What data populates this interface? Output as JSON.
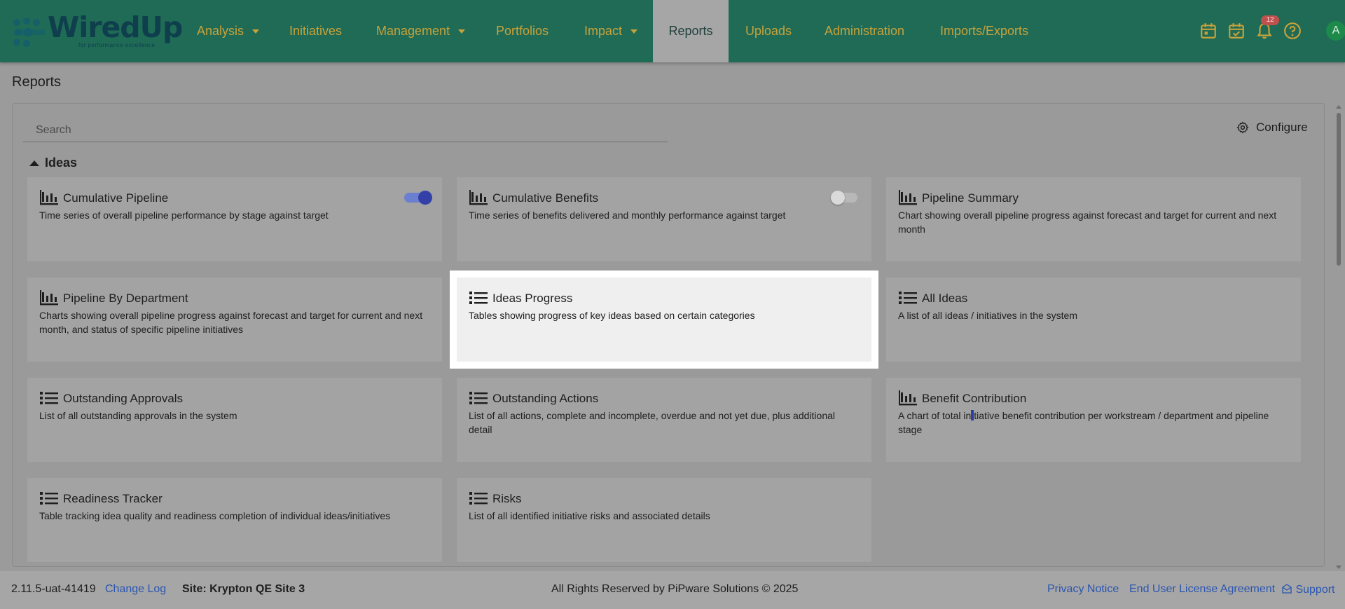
{
  "app": {
    "logo_text": "WiredUp",
    "logo_tagline": "for performance excellence"
  },
  "nav": {
    "items": [
      {
        "label": "Analysis",
        "has_dropdown": true
      },
      {
        "label": "Initiatives",
        "has_dropdown": false
      },
      {
        "label": "Management",
        "has_dropdown": true
      },
      {
        "label": "Portfolios",
        "has_dropdown": false
      },
      {
        "label": "Impact",
        "has_dropdown": true
      },
      {
        "label": "Reports",
        "has_dropdown": false,
        "active": true
      },
      {
        "label": "Uploads",
        "has_dropdown": false
      },
      {
        "label": "Administration",
        "has_dropdown": false
      },
      {
        "label": "Imports/Exports",
        "has_dropdown": false
      }
    ],
    "icons": [
      "calendar-icon",
      "calendar-check-icon",
      "bell-icon",
      "help-icon"
    ],
    "notification_count": "12",
    "avatar_initial": "A"
  },
  "page": {
    "title": "Reports"
  },
  "search": {
    "placeholder": "Search",
    "value": ""
  },
  "configure_label": "Configure",
  "section": {
    "title": "Ideas",
    "expanded": true
  },
  "cards": [
    {
      "title": "Cumulative Pipeline",
      "desc": "Time series of overall pipeline performance by stage against target",
      "icon": "bar-chart-icon",
      "toggle": "on"
    },
    {
      "title": "Cumulative Benefits",
      "desc": "Time series of benefits delivered and monthly performance against target",
      "icon": "bar-chart-icon",
      "toggle": "off"
    },
    {
      "title": "Pipeline Summary",
      "desc": "Chart showing overall pipeline progress against forecast and target for current and next month",
      "icon": "bar-chart-icon"
    },
    {
      "title": "Pipeline By Department",
      "desc": "Charts showing overall pipeline progress against forecast and target for current and next month, and status of specific pipeline initiatives",
      "icon": "bar-chart-icon"
    },
    {
      "title": "Ideas Progress",
      "desc": "Tables showing progress of key ideas based on certain categories",
      "icon": "list-icon",
      "highlighted": true
    },
    {
      "title": "All Ideas",
      "desc": "A list of all ideas / initiatives in the system",
      "icon": "list-icon"
    },
    {
      "title": "Outstanding Approvals",
      "desc": "List of all outstanding approvals in the system",
      "icon": "list-icon"
    },
    {
      "title": "Outstanding Actions",
      "desc": "List of all actions, complete and incomplete, overdue and not yet due, plus additional detail",
      "icon": "list-icon"
    },
    {
      "title": "Benefit Contribution",
      "desc_before": "A chart of total in",
      "desc_after": "tiative benefit contribution per workstream / department and pipeline stage",
      "icon": "bar-chart-icon"
    },
    {
      "title": "Readiness Tracker",
      "desc": "Table tracking idea quality and readiness completion of individual ideas/initiatives",
      "icon": "list-icon"
    },
    {
      "title": "Risks",
      "desc": "List of all identified initiative risks and associated details",
      "icon": "list-icon"
    }
  ],
  "footer": {
    "version": "2.11.5-uat-41419",
    "change_log": "Change Log",
    "site": "Site: Krypton QE Site 3",
    "copyright": "All Rights Reserved by PiPware Solutions © 2025",
    "privacy": "Privacy Notice",
    "eula": "End User License Agreement",
    "support": "Support"
  },
  "colors": {
    "navbar": "#1f6b56",
    "nav_text": "#c8a23a",
    "link": "#2a55b0",
    "toggle_on": "#3340a8",
    "badge": "#c0504d"
  }
}
